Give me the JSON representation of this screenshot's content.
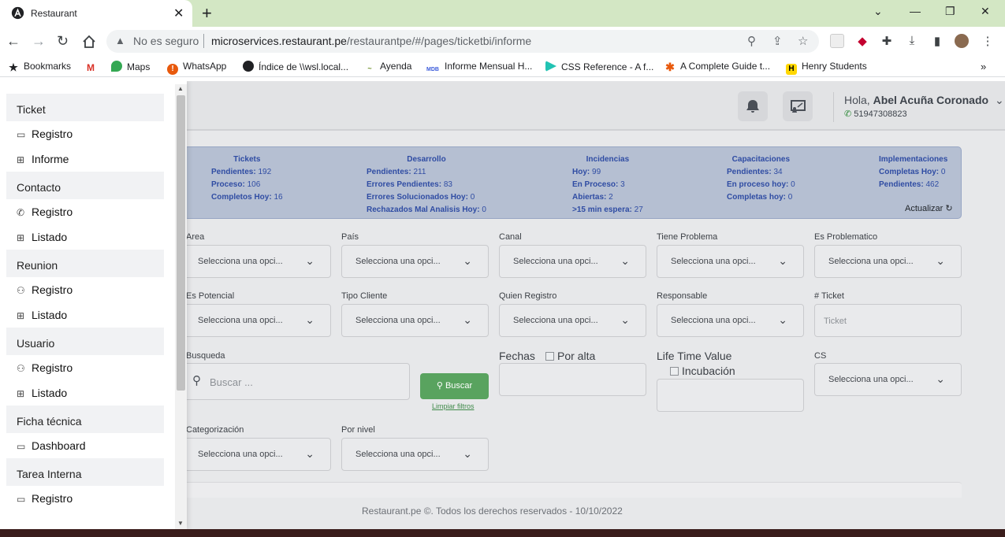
{
  "browser": {
    "tab_title": "Restaurant",
    "security_label": "No es seguro",
    "url_host": "microservices.restaurant.pe",
    "url_path": "/restaurantpe/#/pages/ticketbi/informe",
    "bookmarks": [
      {
        "label": "Bookmarks",
        "icon": "star-icon"
      },
      {
        "label": "",
        "icon": "gmail-icon"
      },
      {
        "label": "Maps",
        "icon": "maps-icon"
      },
      {
        "label": "WhatsApp",
        "icon": "whatsapp-icon"
      },
      {
        "label": "Índice de \\\\wsl.local...",
        "icon": "globe-icon"
      },
      {
        "label": "Ayenda",
        "icon": "ayenda-icon"
      },
      {
        "label": "Informe Mensual H...",
        "icon": "mdb-icon"
      },
      {
        "label": "CSS Reference - A f...",
        "icon": "css-icon"
      },
      {
        "label": "A Complete Guide t...",
        "icon": "tricks-icon"
      },
      {
        "label": "Henry Students",
        "icon": "henry-icon"
      }
    ]
  },
  "header": {
    "greeting_prefix": "Hola,",
    "user_name": "Abel Acuña Coronado",
    "phone": "51947308823"
  },
  "sidebar": {
    "items": [
      {
        "type": "group",
        "label": "Ticket"
      },
      {
        "type": "item",
        "label": "Registro",
        "icon": "ticket-icon"
      },
      {
        "type": "item",
        "label": "Informe",
        "icon": "table-icon"
      },
      {
        "type": "group",
        "label": "Contacto"
      },
      {
        "type": "item",
        "label": "Registro",
        "icon": "phone-icon"
      },
      {
        "type": "item",
        "label": "Listado",
        "icon": "table-icon"
      },
      {
        "type": "group",
        "label": "Reunion"
      },
      {
        "type": "item",
        "label": "Registro",
        "icon": "users-icon"
      },
      {
        "type": "item",
        "label": "Listado",
        "icon": "table-icon"
      },
      {
        "type": "group",
        "label": "Usuario"
      },
      {
        "type": "item",
        "label": "Registro",
        "icon": "users-icon"
      },
      {
        "type": "item",
        "label": "Listado",
        "icon": "table-icon"
      },
      {
        "type": "group",
        "label": "Ficha técnica"
      },
      {
        "type": "item",
        "label": "Dashboard",
        "icon": "ticket-icon"
      },
      {
        "type": "group",
        "label": "Tarea Interna"
      },
      {
        "type": "item",
        "label": "Registro",
        "icon": "ticket-icon"
      }
    ]
  },
  "stats": {
    "tickets": {
      "title": "Tickets",
      "rows": [
        [
          "Pendientes:",
          "192"
        ],
        [
          "Proceso:",
          "106"
        ],
        [
          "Completos Hoy:",
          "16"
        ]
      ]
    },
    "desarrollo": {
      "title": "Desarrollo",
      "rows": [
        [
          "Pendientes:",
          "211"
        ],
        [
          "Errores Pendientes:",
          "83"
        ],
        [
          "Errores Solucionados Hoy:",
          "0"
        ],
        [
          "Rechazados Mal Analisis Hoy:",
          "0"
        ]
      ]
    },
    "incidencias": {
      "title": "Incidencias",
      "rows": [
        [
          "Hoy:",
          "99"
        ],
        [
          "En Proceso:",
          "3"
        ],
        [
          "Abiertas:",
          "2"
        ],
        [
          ">15 min espera:",
          "27"
        ]
      ]
    },
    "capacitaciones": {
      "title": "Capacitaciones",
      "rows": [
        [
          "Pendientes:",
          "34"
        ],
        [
          "En proceso hoy:",
          "0"
        ],
        [
          "Completas hoy:",
          "0"
        ]
      ]
    },
    "implementaciones": {
      "title": "Implementaciones",
      "rows": [
        [
          "Completas Hoy:",
          "0"
        ],
        [
          "Pendientes:",
          "462"
        ]
      ]
    },
    "refresh_label": "Actualizar"
  },
  "filters": {
    "select_placeholder": "Selecciona una opci...",
    "area": "Area",
    "pais": "País",
    "canal": "Canal",
    "tiene_problema": "Tiene Problema",
    "es_problematico": "Es Problematico",
    "es_potencial": "Es Potencial",
    "tipo_cliente": "Tipo Cliente",
    "quien_registro": "Quien Registro",
    "responsable": "Responsable",
    "ticket_label": "# Ticket",
    "ticket_placeholder": "Ticket",
    "busqueda": "Busqueda",
    "buscar_placeholder": "Buscar ...",
    "buscar_button": "Buscar",
    "limpiar": "Limpiar filtros",
    "fechas": "Fechas",
    "por_alta": "Por alta",
    "life_time_value": "Life Time Value",
    "incubacion": "Incubación",
    "cs": "CS",
    "categorizacion": "Categorización",
    "por_nivel": "Por nivel"
  },
  "footer": {
    "text": "Restaurant.pe ©. Todos los derechos reservados - 10/10/2022"
  }
}
